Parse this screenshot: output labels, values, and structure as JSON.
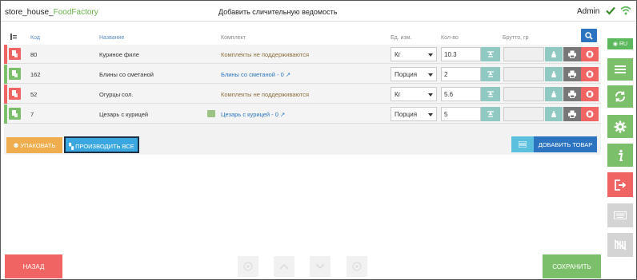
{
  "header": {
    "brand_prefix": "store_house_",
    "brand_accent": "FoodFactory",
    "title": "Добавить сличительную ведомость",
    "user": "Admin"
  },
  "table": {
    "columns": {
      "code": "Код",
      "name": "Название",
      "kit": "Комплект",
      "unit": "Ед. изм.",
      "qty": "Кол-во",
      "gross": "Брутто, гр"
    },
    "rows": [
      {
        "code": "80",
        "name": "Куриное филе",
        "kit": "Комплекты не поддерживаются",
        "unit": "Кг",
        "qty": "10.3"
      },
      {
        "code": "162",
        "name": "Блины со сметаной",
        "kit": "Блины со сметаной - 0 ↗",
        "unit": "Порция",
        "qty": "2"
      },
      {
        "code": "52",
        "name": "Огурцы сол.",
        "kit": "Комплекты не поддерживаются",
        "unit": "Кг",
        "qty": "5.6"
      },
      {
        "code": "7",
        "name": "Цезарь с курицей",
        "kit": "Цезарь с курицей - 0 ↗",
        "unit": "Порция",
        "qty": "5"
      }
    ]
  },
  "actions": {
    "pack": "УПАКОВАТЬ",
    "produce_all": "ПРОИЗВОДИТЬ ВСЕ",
    "add_product": "ДОБАВИТЬ ТОВАР"
  },
  "sidebar": {
    "lang": "RU"
  },
  "footer": {
    "back": "НАЗАД",
    "save": "СОХРАНИТЬ"
  },
  "colors": {
    "accent_green": "#6ab04c",
    "primary_blue": "#2d74c0",
    "danger_red": "#f06464",
    "teal": "#8fc9c2",
    "orange": "#f0ad4e"
  }
}
